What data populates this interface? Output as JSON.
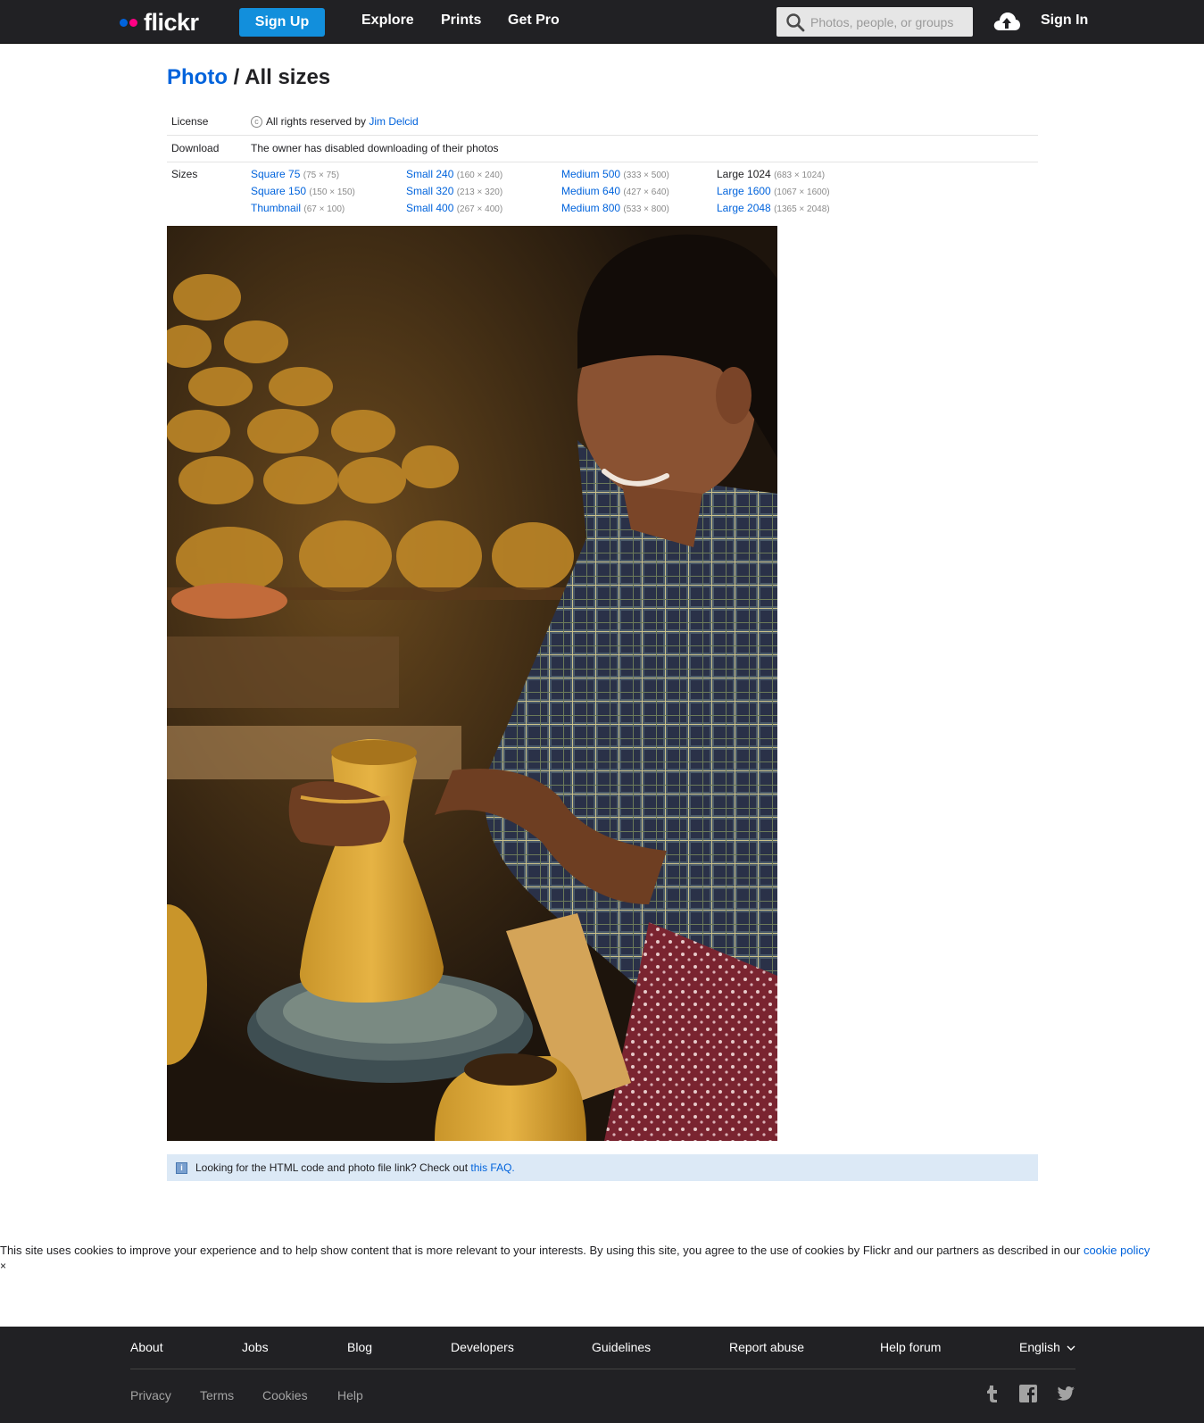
{
  "header": {
    "logo_text": "flickr",
    "signup_label": "Sign Up",
    "nav": [
      "Explore",
      "Prints",
      "Get Pro"
    ],
    "search_placeholder": "Photos, people, or groups",
    "signin_label": "Sign In"
  },
  "title": {
    "crumb": "Photo",
    "sep": " / ",
    "current": "All sizes"
  },
  "info": {
    "license_label": "License",
    "license_text": "All rights reserved by ",
    "owner": "Jim Delcid",
    "download_label": "Download",
    "download_text": "The owner has disabled downloading of their photos",
    "sizes_label": "Sizes",
    "sizes": [
      {
        "name": "Square 75",
        "dim": "(75 × 75)"
      },
      {
        "name": "Small 240",
        "dim": "(160 × 240)"
      },
      {
        "name": "Medium 500",
        "dim": "(333 × 500)"
      },
      {
        "name": "Large 1024",
        "dim": "(683 × 1024)"
      },
      {
        "name": "Square 150",
        "dim": "(150 × 150)"
      },
      {
        "name": "Small 320",
        "dim": "(213 × 320)"
      },
      {
        "name": "Medium 640",
        "dim": "(427 × 640)"
      },
      {
        "name": "Large 1600",
        "dim": "(1067 × 1600)"
      },
      {
        "name": "Thumbnail",
        "dim": "(67 × 100)"
      },
      {
        "name": "Small 400",
        "dim": "(267 × 400)"
      },
      {
        "name": "Medium 800",
        "dim": "(533 × 800)"
      },
      {
        "name": "Large 2048",
        "dim": "(1365 × 2048)"
      }
    ],
    "current_size": "Large 1024"
  },
  "faq": {
    "text": "Looking for the HTML code and photo file link? Check out ",
    "link": "this FAQ."
  },
  "cookie": {
    "text": "This site uses cookies to improve your experience and to help show content that is more relevant to your interests. By using this site, you agree to the use of cookies by Flickr and our partners as described in our ",
    "link": "cookie policy",
    "close": "×"
  },
  "footer": {
    "links": [
      "About",
      "Jobs",
      "Blog",
      "Developers",
      "Guidelines",
      "Report abuse",
      "Help forum",
      "English"
    ],
    "small_links": [
      "Privacy",
      "Terms",
      "Cookies",
      "Help"
    ],
    "social_icons": [
      "tumblr-icon",
      "facebook-icon",
      "twitter-icon"
    ]
  },
  "colors": {
    "brand_blue": "#0063dc",
    "brand_pink": "#ff0084",
    "signup_blue": "#128fdc",
    "header_bg": "#212124"
  }
}
